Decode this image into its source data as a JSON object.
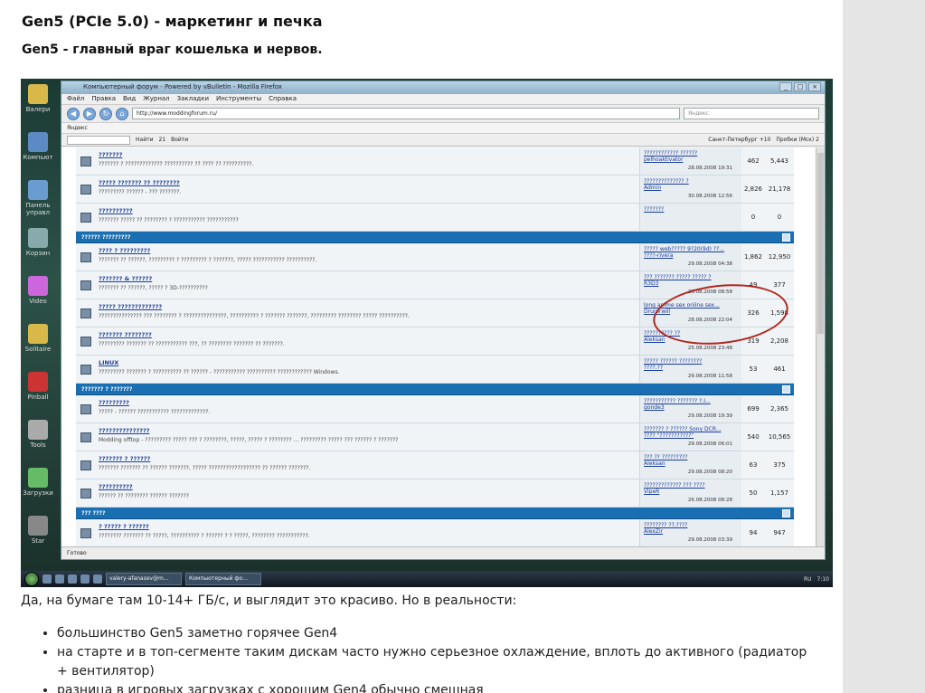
{
  "article": {
    "title": "Gen5 (PCIe 5.0) - маркетинг и печка",
    "subtitle": "Gen5 - главный враг кошелька и нервов.",
    "lead": "Да, на бумаге там 10-14+ ГБ/с, и выглядит это красиво. Но в реальности:",
    "bullets": [
      "большинство Gen5 заметно горячее Gen4",
      "на старте и в топ-сегменте таким дискам часто нужно серьезное охлаждение, вплоть до активного (радиатор + вентилятор)",
      "разница в игровых загрузках с хорошим Gen4 обычно смешная"
    ]
  },
  "screenshot": {
    "desktop_icons": [
      "Валери",
      "Компьют",
      "Панель управл",
      "Корзин",
      "Video",
      "Solitaire",
      "Pinball",
      "Tools",
      "Загрузки",
      "Star"
    ],
    "window_title": "Компьютерный форум - Powered by vBulletin - Mozilla Firefox",
    "menu": [
      "Файл",
      "Правка",
      "Вид",
      "Журнал",
      "Закладки",
      "Инструменты",
      "Справка"
    ],
    "url": "http://www.moddingforum.ru/",
    "search_placeholder": "Яндекс",
    "bookmark": "Яндекс",
    "yandex_toolbar": {
      "find": "Найти",
      "count": "21",
      "login": "Войти",
      "city": "Санкт-Петербург +10",
      "traffic": "Пробки (Мск) 2"
    },
    "categories": [
      "?????? ?????????",
      "??????? ? ???????",
      "??? ????"
    ],
    "rows": [
      {
        "title": "???????",
        "desc": "??????? ? ????????????? ?????????? ?? ???? ?? ??????????.",
        "last": "???????????? ??????",
        "user": "pelhoaktivator",
        "date": "28.08.2008 19:31",
        "threads": "462",
        "posts": "5,443"
      },
      {
        "title": "????? ??????? ?? ????????",
        "desc": "????????? ?????? - ??? ???????.",
        "last": "?????????????? ?",
        "user": "Admin",
        "date": "30.08.2008 12:56",
        "threads": "2,826",
        "posts": "21,178"
      },
      {
        "title": "??????????",
        "desc": "??????? ????? ?? ???????? ? ??????????? ???????????",
        "last": "???????",
        "user": "",
        "date": "",
        "threads": "0",
        "posts": "0"
      },
      {
        "title": "???? ? ?????????",
        "desc": "??????? ?? ??????, ????????? ? ????????? ? ???????, ????? ??????????? ??????????.",
        "last": "????? web????? 9?20(9d) ??...",
        "user": "????-rivera",
        "date": "29.08.2008 04:38",
        "threads": "1,862",
        "posts": "12,950"
      },
      {
        "title": "??????? & ??????",
        "desc": "??????? ?? ??????, ????? ? 3D-??????????",
        "last": "??? ??????? ????? ????? ?",
        "user": "R3D3",
        "date": "26.08.2008 08:58",
        "threads": "49",
        "posts": "377"
      },
      {
        "title": "????? ?????????????",
        "desc": "??????????????? ??? ???????? ? ???????????????, ?????????? ? ??????? ???????, ????????? ???????? ????? ??????????.",
        "last": "long anime sex online sex...",
        "user": "Drurorwill",
        "date": "28.08.2008 22:04",
        "threads": "326",
        "posts": "1,598"
      },
      {
        "title": "??????? ????????",
        "desc": "????????? ??????? ?? ??????????? ???, ?? ???????? ??????? ?? ???????.",
        "last": "?????????? ??",
        "user": "Aleksan",
        "date": "25.08.2008 23:48",
        "threads": "319",
        "posts": "2,208"
      },
      {
        "title": "LINUX",
        "desc": "????????? ??????? ? ?????????? ?? ?????? - ??????????? ?????????? ???????????? Windows.",
        "last": "????? ?????? ????????",
        "user": "????.??",
        "date": "29.08.2008 11:58",
        "threads": "53",
        "posts": "461"
      },
      {
        "title": "?????????",
        "desc": "????? - ?????? ??????????? ?????????????.",
        "last": "??????????? ??????? ?.I...",
        "user": "gonde3",
        "date": "29.08.2008 19:39",
        "threads": "699",
        "posts": "2,365"
      },
      {
        "title": "???????????????",
        "desc": "Modding offtop - ????????? ????? ??? ? ????????, ?????, ????? ? ???????? ... ????????? ????? ??? ?????? ? ???????",
        "last": "??????? ? ?????? Sony DCR...",
        "user": "???? \"???????????\"",
        "date": "29.08.2008 06:01",
        "threads": "540",
        "posts": "10,565"
      },
      {
        "title": "??????? ? ??????",
        "desc": "??????? ??????? ?? ?????? ???????, ????? ?????????????????? ?? ?????? ???????.",
        "last": "??? ?? ?????????",
        "user": "Aleksan",
        "date": "29.08.2008 08:20",
        "threads": "63",
        "posts": "375"
      },
      {
        "title": "??????????",
        "desc": "?????? ?? ???????? ?????? ???????",
        "last": "????????????? ??? ????",
        "user": "VipeR",
        "date": "26.08.2008 08:28",
        "threads": "50",
        "posts": "1,157"
      },
      {
        "title": "? ????? ? ??????",
        "desc": "???????? ??????? ?? ?????, ?????????? ? ?????? ? ? ?????, ???????? ???????????.",
        "last": "???????? ??.????",
        "user": "AlexZir",
        "date": "29.08.2008 03:39",
        "threads": "94",
        "posts": "947"
      }
    ],
    "footer_links": "??? ?????? ??????? - ??????? ?????",
    "status": "Готово",
    "taskbar": {
      "items": [
        "valery-afanasev@m...",
        "Компьютерный фо..."
      ],
      "lang": "RU",
      "time": "7:10"
    }
  }
}
